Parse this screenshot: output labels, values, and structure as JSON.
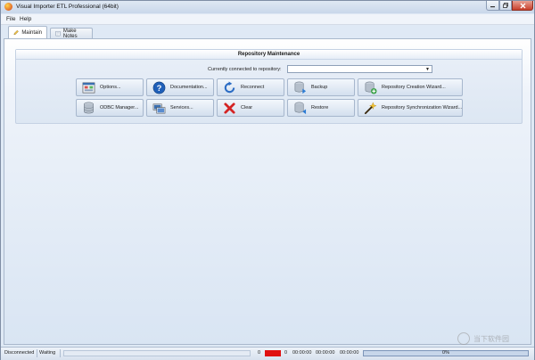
{
  "window": {
    "title": "Visual Importer ETL Professional (64bit)"
  },
  "menu": {
    "file": "File",
    "help": "Help"
  },
  "tabs": [
    {
      "label": "Maintain",
      "icon": "pencil-icon",
      "active": true
    },
    {
      "label": "Make Notes",
      "icon": "notepad-icon",
      "active": false
    }
  ],
  "repository": {
    "title": "Repository Maintenance",
    "connected_label": "Currently connected to repository:",
    "connected_value": ""
  },
  "buttons": {
    "options": "Options...",
    "documentation": "Documentation...",
    "reconnect": "Reconnect",
    "backup": "Backup",
    "creation_wizard": "Repository Creation Wizard...",
    "odbc": "ODBC Manager...",
    "services": "Services...",
    "clear": "Clear",
    "restore": "Restore",
    "sync_wizard": "Repository Synchronization Wizard..."
  },
  "status": {
    "connection": "Disconnected",
    "state": "Waiting",
    "count_a": "0",
    "count_b": "0",
    "time_1": "00:00:00",
    "time_2": "00:00:00",
    "time_3": "00:00:00",
    "progress_label": "0%",
    "progress": 0
  },
  "watermark": {
    "text": "当下软件园"
  },
  "colors": {
    "accent": "#3a6fb0",
    "error_indicator": "#e01010"
  }
}
